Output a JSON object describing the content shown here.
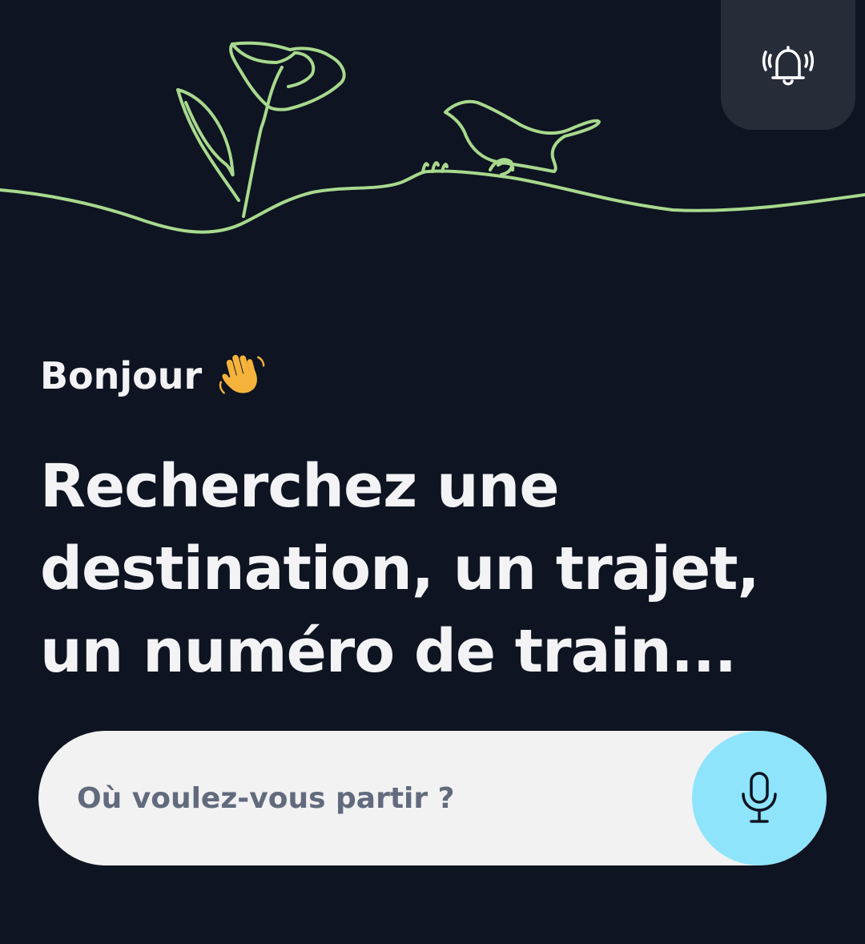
{
  "header": {
    "illustration": "flower-and-bird-line-drawing",
    "alert_icon": "bell-ringing-icon",
    "alert_button_bg": "#262c38",
    "line_color": "#a8d98e"
  },
  "main": {
    "greeting": "Bonjour",
    "greeting_emoji": "waving-hand-icon",
    "headline": "Recherchez une destination, un trajet, un numéro de train..."
  },
  "search": {
    "placeholder": "Où voulez-vous partir ?",
    "value": "",
    "mic_icon": "microphone-icon",
    "mic_button_color": "#8ee4fb"
  },
  "colors": {
    "background": "#0e1421",
    "text": "#f3f3f5",
    "search_bg": "#f2f2f3",
    "placeholder": "#626b7d"
  }
}
